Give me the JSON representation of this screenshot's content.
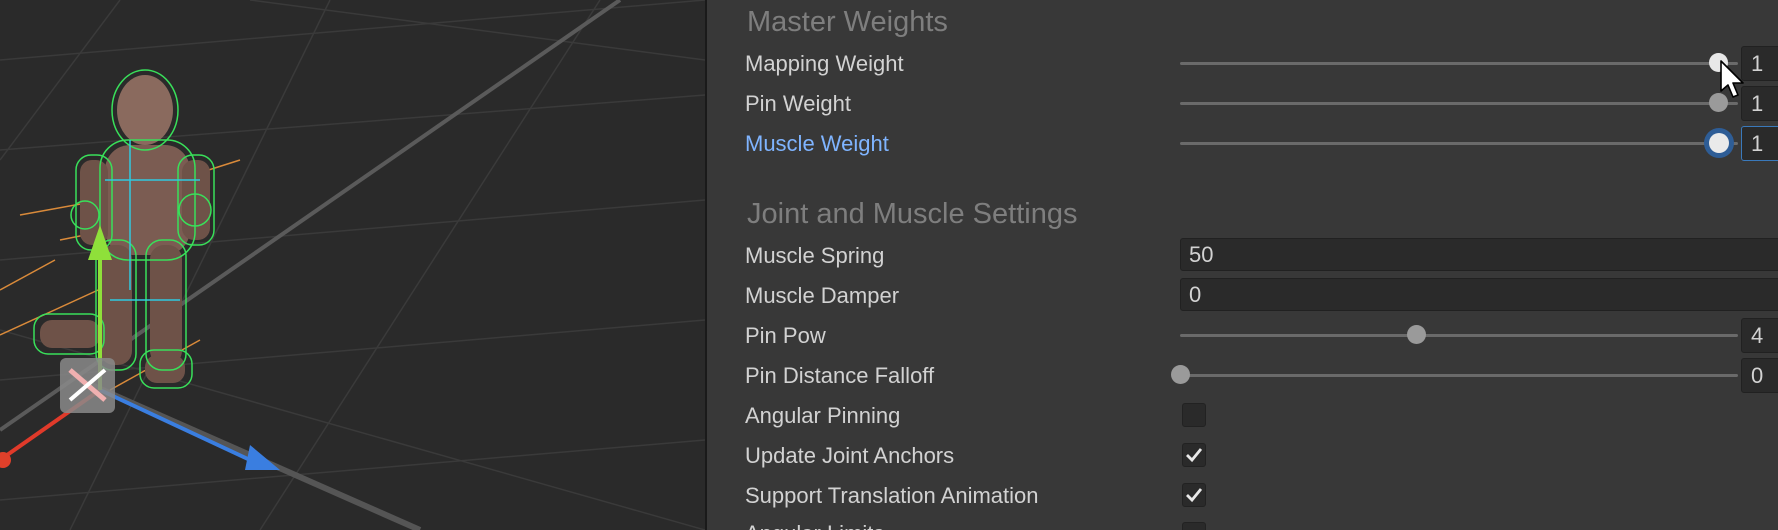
{
  "inspector": {
    "master_weights": {
      "header": "Master Weights",
      "mapping_weight": {
        "label": "Mapping Weight",
        "value": "1",
        "fraction": 1.0
      },
      "pin_weight": {
        "label": "Pin Weight",
        "value": "1",
        "fraction": 1.0
      },
      "muscle_weight": {
        "label": "Muscle Weight",
        "value": "1",
        "fraction": 1.0
      }
    },
    "joint_muscle": {
      "header": "Joint and Muscle Settings",
      "muscle_spring": {
        "label": "Muscle Spring",
        "value": "50"
      },
      "muscle_damper": {
        "label": "Muscle Damper",
        "value": "0"
      },
      "pin_pow": {
        "label": "Pin Pow",
        "value": "4",
        "fraction": 0.43
      },
      "pin_distance_falloff": {
        "label": "Pin Distance Falloff",
        "value": "0",
        "fraction": 0.0
      },
      "angular_pinning": {
        "label": "Angular Pinning",
        "checked": false
      },
      "update_joint_anchors": {
        "label": "Update Joint Anchors",
        "checked": true
      },
      "support_translation_animation": {
        "label": "Support Translation Animation",
        "checked": true
      },
      "angular_limits": {
        "label": "Angular Limits"
      }
    }
  },
  "colors": {
    "accent": "#3a79bb",
    "active_label": "#7fb4ff",
    "panel_bg": "#383838",
    "scene_bg": "#2a2a2a"
  }
}
